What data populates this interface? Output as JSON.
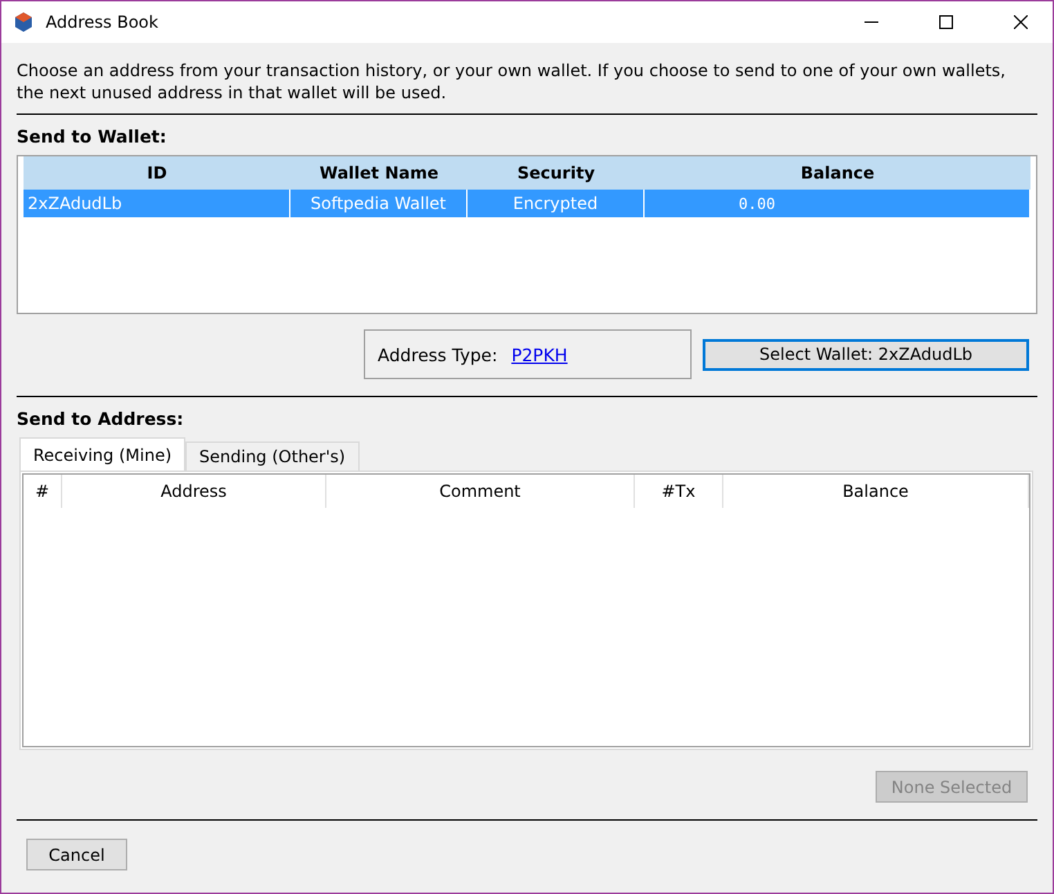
{
  "window": {
    "title": "Address Book"
  },
  "description": "Choose an address from your transaction history, or your own wallet. If you choose to send to one of your own wallets, the next unused address in that wallet will be used.",
  "wallet_section": {
    "heading": "Send to Wallet:",
    "columns": [
      "ID",
      "Wallet Name",
      "Security",
      "Balance"
    ],
    "rows": [
      {
        "cells": [
          "2xZAdudLb",
          "Softpedia Wallet",
          "Encrypted",
          "0.00"
        ],
        "selected": true
      }
    ],
    "address_type": {
      "label": "Address Type:",
      "value": "P2PKH"
    },
    "select_button": {
      "label": "Select Wallet: 2xZAdudLb",
      "disabled": false
    }
  },
  "address_section": {
    "heading": "Send to Address:",
    "tabs": [
      {
        "label": "Receiving (Mine)",
        "selected": true
      },
      {
        "label": "Sending (Other's)",
        "selected": false
      }
    ],
    "columns": [
      "#",
      "Address",
      "Comment",
      "#Tx",
      "Balance"
    ],
    "select_button": {
      "label": "None Selected",
      "disabled": true
    }
  },
  "cancel_button": {
    "label": "Cancel"
  }
}
